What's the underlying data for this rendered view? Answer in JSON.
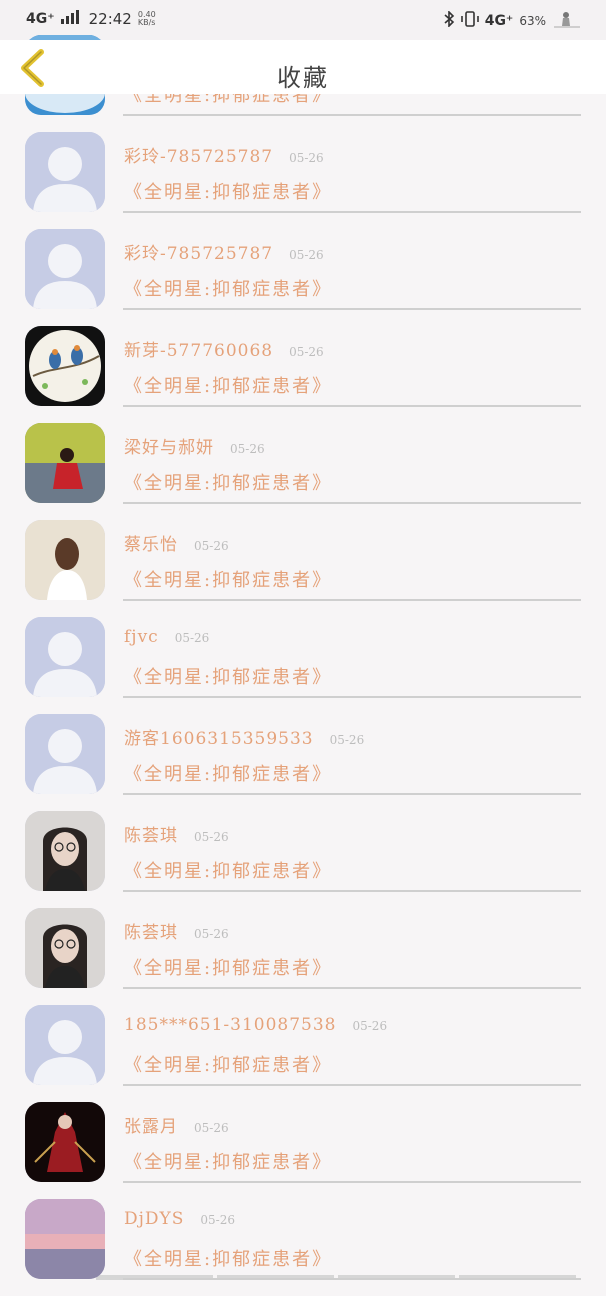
{
  "status_bar": {
    "network": "4G⁺",
    "time": "22:42",
    "speed": "0.40 KB/s",
    "network_right": "4G⁺",
    "battery": "63%"
  },
  "header": {
    "title": "收藏"
  },
  "items": [
    {
      "name": "",
      "date": "",
      "post": "《全明星:抑郁症患者》",
      "avatar": "sky"
    },
    {
      "name": "彩玲-785725787",
      "date": "05-26",
      "post": "《全明星:抑郁症患者》",
      "avatar": "default"
    },
    {
      "name": "彩玲-785725787",
      "date": "05-26",
      "post": "《全明星:抑郁症患者》",
      "avatar": "default"
    },
    {
      "name": "新芽-577760068",
      "date": "05-26",
      "post": "《全明星:抑郁症患者》",
      "avatar": "birds"
    },
    {
      "name": "梁好与郝妍",
      "date": "05-26",
      "post": "《全明星:抑郁症患者》",
      "avatar": "red-dress"
    },
    {
      "name": "蔡乐怡",
      "date": "05-26",
      "post": "《全明星:抑郁症患者》",
      "avatar": "girl-back"
    },
    {
      "name": "fjvc",
      "date": "05-26",
      "post": "《全明星:抑郁症患者》",
      "avatar": "default"
    },
    {
      "name": "游客1606315359533",
      "date": "05-26",
      "post": "《全明星:抑郁症患者》",
      "avatar": "default"
    },
    {
      "name": "陈荟琪",
      "date": "05-26",
      "post": "《全明星:抑郁症患者》",
      "avatar": "glasses-girl"
    },
    {
      "name": "陈荟琪",
      "date": "05-26",
      "post": "《全明星:抑郁症患者》",
      "avatar": "glasses-girl"
    },
    {
      "name": "185***651-310087538",
      "date": "05-26",
      "post": "《全明星:抑郁症患者》",
      "avatar": "default"
    },
    {
      "name": "张露月",
      "date": "05-26",
      "post": "《全明星:抑郁症患者》",
      "avatar": "warrior"
    },
    {
      "name": "DjDYS",
      "date": "05-26",
      "post": "《全明星:抑郁症患者》",
      "avatar": "sunset"
    }
  ],
  "colors": {
    "accent": "#e5a27a",
    "date": "#bdbdbd",
    "back_arrow": "#e2c230"
  }
}
